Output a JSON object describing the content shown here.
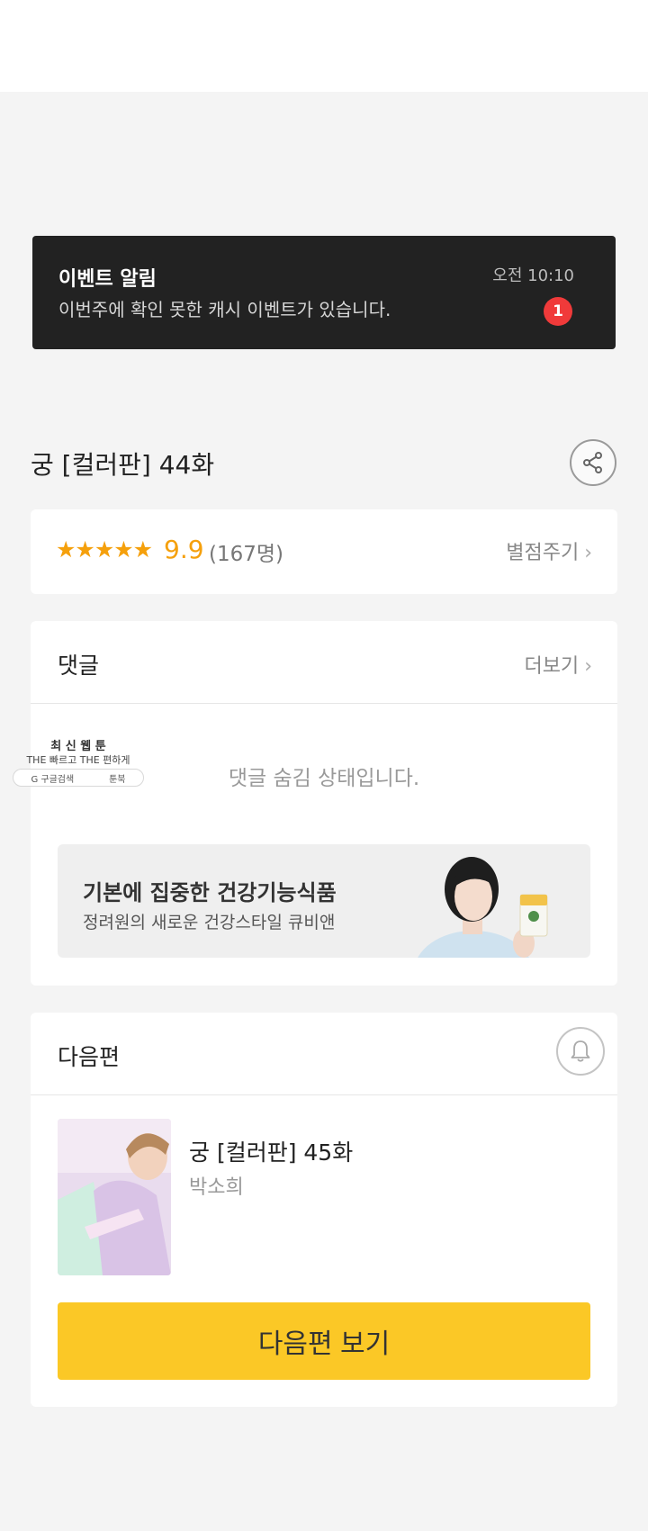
{
  "notification": {
    "title": "이벤트 알림",
    "message": "이번주에 확인 못한 캐시 이벤트가 있습니다.",
    "time": "오전 10:10",
    "badge_count": "1"
  },
  "episode": {
    "title": "궁 [컬러판] 44화",
    "share_icon": "share-icon"
  },
  "rating": {
    "stars": "★★★★★",
    "score": "9.9",
    "count": "(167명)",
    "rate_label": "별점주기",
    "accent_color": "#f5a00c"
  },
  "comments": {
    "title": "댓글",
    "more_label": "더보기",
    "hidden_message": "댓글 숨김 상태입니다."
  },
  "promo": {
    "line1": "최 신 웹 툰",
    "line2": "THE 빠르고 THE 편하게",
    "pill_google": "G 구글검색",
    "pill_toon": "툰북"
  },
  "ad": {
    "title": "기본에 집중한 건강기능식품",
    "subtitle": "정려원의 새로운 건강스타일 큐비앤"
  },
  "next_episode": {
    "section_title": "다음편",
    "title": "궁 [컬러판] 45화",
    "author": "박소희",
    "button_label": "다음편 보기",
    "button_color": "#fbc826"
  }
}
